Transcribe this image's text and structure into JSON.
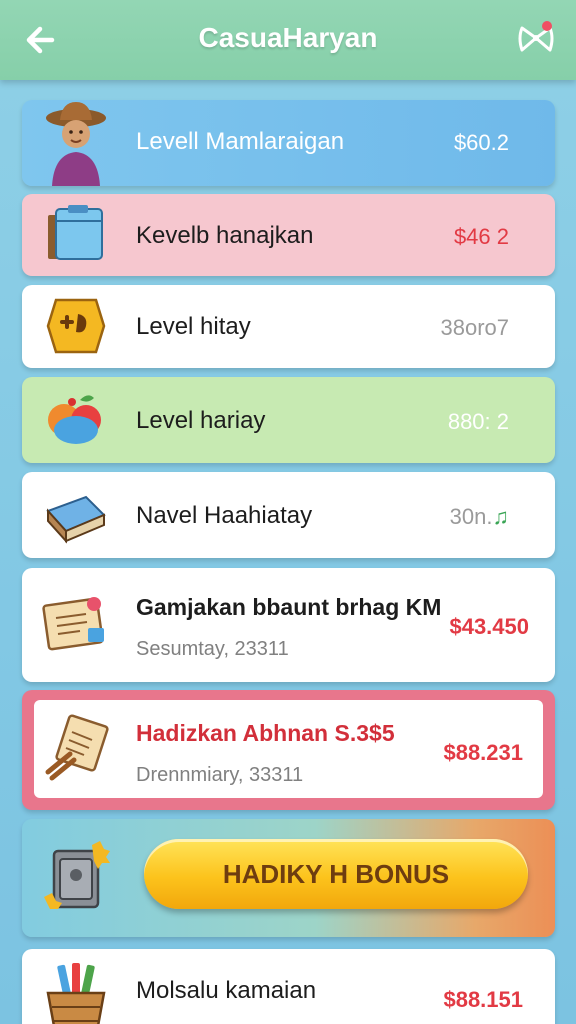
{
  "header": {
    "title": "CasuaHaryan",
    "back_icon": "arrow-left-icon",
    "menu_icon": "ribbon-logo-icon"
  },
  "rows": [
    {
      "label": "Levell Mamlaraigan",
      "value": "$60.2",
      "icon": "farmer-avatar-icon"
    },
    {
      "label": "Kevelb hanajkan",
      "value": "$46 2",
      "icon": "blue-box-icon"
    },
    {
      "label": "Level hitay",
      "value": "38oro7",
      "icon": "gold-badge-icon"
    },
    {
      "label": "Level hariay",
      "value": "880: 2",
      "icon": "fruit-basket-icon"
    },
    {
      "label": "Navel Haahiatay",
      "value": "30n.",
      "icon": "book-stack-icon"
    }
  ],
  "detail_rows": [
    {
      "title": "Gamjakan bbaunt brhag KM",
      "subtitle": "Sesumtay, 23311",
      "value": "$43.450",
      "icon": "scroll-letter-icon"
    },
    {
      "title": "Hadizkan Abhnan S.3$5",
      "subtitle": "Drennmiary, 33311",
      "value": "$88.231",
      "icon": "parchment-icon"
    }
  ],
  "bonus": {
    "label": "HADIKY H BONUS",
    "icon": "treasure-safe-icon"
  },
  "last_row": {
    "label": "Molsalu kamaian",
    "value": "$88.151",
    "icon": "basket-icon"
  },
  "colors": {
    "header": "#8dd3af",
    "background": "#85c9e4",
    "row1": "#75c1ea",
    "row2": "#f5c7cf",
    "row4": "#c7eab2",
    "price_red": "#e23a44",
    "price_gray": "#9a9a9a",
    "accent_frame": "#e56f87"
  }
}
